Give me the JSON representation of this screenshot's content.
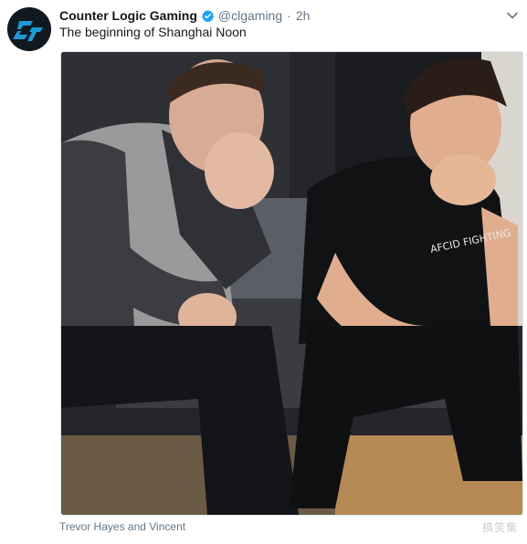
{
  "tweet": {
    "display_name": "Counter Logic Gaming",
    "verified_icon": "verified-badge-icon",
    "handle": "@clgaming",
    "separator": "·",
    "time": "2h",
    "text": "The beginning of Shanghai Noon",
    "caption": "Trevor Hayes and Vincent",
    "menu_icon": "chevron-down-icon"
  },
  "avatar": {
    "logo_text": "CLG",
    "brand_color": "#1c9ad6"
  },
  "photo": {
    "shirt_text": "AFCID FIGHTING"
  },
  "watermark": "搞笑集",
  "colors": {
    "name": "#14171a",
    "meta": "#657786",
    "verified": "#1da1f2",
    "border": "#e1e8ed"
  }
}
